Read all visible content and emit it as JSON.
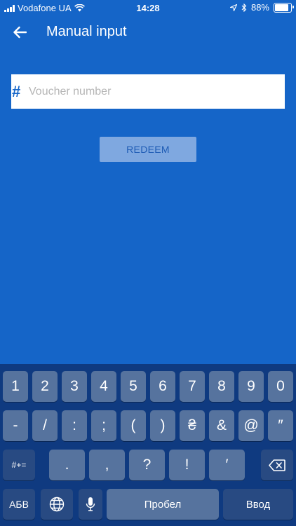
{
  "status_bar": {
    "carrier": "Vodafone UA",
    "time": "14:28",
    "battery": "88%",
    "battery_level": 0.88
  },
  "app_bar": {
    "title": "Manual input",
    "back_icon": "arrow-left-icon"
  },
  "voucher": {
    "prefix": "#",
    "placeholder": "Voucher number",
    "value": ""
  },
  "redeem": {
    "label": "REDEEM"
  },
  "keyboard": {
    "row1": [
      "1",
      "2",
      "3",
      "4",
      "5",
      "6",
      "7",
      "8",
      "9",
      "0"
    ],
    "row2": [
      "-",
      "/",
      ":",
      ";",
      "(",
      ")",
      "₴",
      "&",
      "@",
      "″"
    ],
    "row3": [
      ".",
      ",",
      "?",
      "!",
      "′"
    ],
    "symbols_label": "#+=",
    "lang_label": "АБВ",
    "space_label": "Пробел",
    "return_label": "Ввод",
    "globe_icon": "globe-icon",
    "mic_icon": "microphone-icon",
    "backspace_icon": "backspace-icon"
  },
  "colors": {
    "background": "#1565c8",
    "keyboard": "#0f3a80",
    "key": "#56739e"
  }
}
